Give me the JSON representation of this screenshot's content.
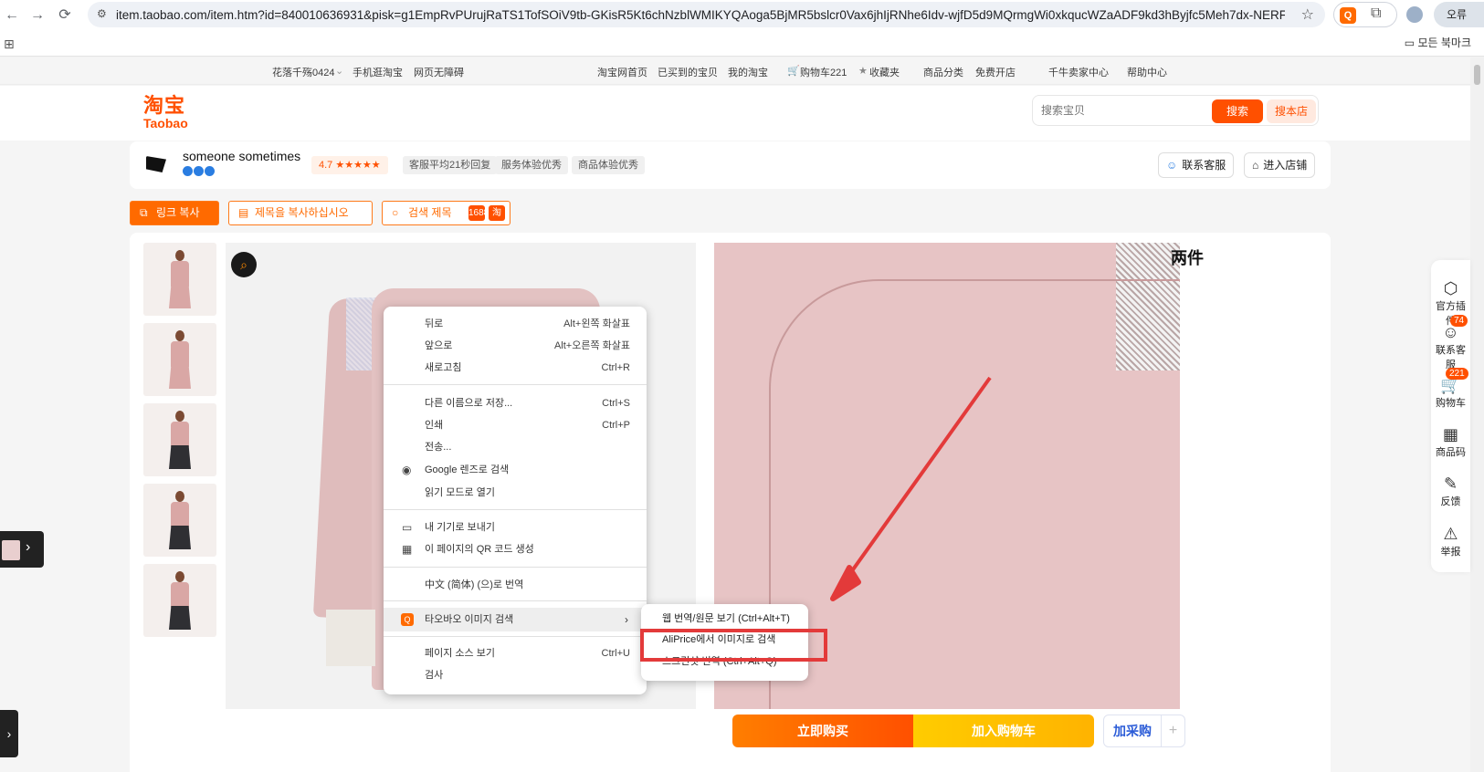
{
  "browser": {
    "url": "item.taobao.com/item.htm?id=840010636931&pisk=g1EmpRvPUrujRaTS1TofSOiV9tb-GKisR5Kt6chNzblWMIKYQAoga5BjMR5bslcr0Vax6jhIjRNhe6Idv-wjfD5d9MQrmgWi0xkqucWZaADF9kd3hByjfc5Meh7dx-NERFZK3AkPEAH...",
    "profile_label": "오류",
    "bookmarks_label": "모든 북마크",
    "ext_ali_label": "Q"
  },
  "topnav": {
    "left": [
      "花落千殇0424",
      "手机逛淘宝",
      "网页无障碍"
    ],
    "right": [
      "淘宝网首页",
      "已买到的宝贝",
      "我的淘宝",
      "购物车221",
      "收藏夹",
      "商品分类",
      "免费开店",
      "千牛卖家中心",
      "帮助中心"
    ]
  },
  "header": {
    "logo_cn": "淘宝",
    "logo_en": "Taobao",
    "search_placeholder": "搜索宝贝",
    "search_button": "搜索",
    "store_button": "搜本店"
  },
  "shop": {
    "name": "someone sometimes",
    "rating": "4.7 ★★★★★",
    "tags": [
      "客服平均21秒回复",
      "服务体验优秀",
      "商品体验优秀"
    ],
    "contact_button": "联系客服",
    "enter_button": "进入店铺"
  },
  "tools": {
    "copy_link": "링크 복사",
    "copy_title": "제목을 복사하십시오",
    "search_title": "검색 제목",
    "mini_a": "1688",
    "mini_b": "淘"
  },
  "product": {
    "title_fragment": "两件",
    "buy_now": "立即购买",
    "add_cart": "加入购物车",
    "purchase": "加采购",
    "plus": "+"
  },
  "sidebar": {
    "items": [
      {
        "label": "官方插件",
        "icon": "plugin-icon"
      },
      {
        "label": "联系客服",
        "icon": "service-icon",
        "badge": "74"
      },
      {
        "label": "购物车",
        "icon": "cart-icon",
        "badge": "221"
      },
      {
        "label": "商品码",
        "icon": "qr-icon"
      },
      {
        "label": "反馈",
        "icon": "edit-icon"
      },
      {
        "label": "举报",
        "icon": "warning-icon"
      }
    ]
  },
  "context_menu": {
    "items": [
      {
        "label": "뒤로",
        "shortcut": "Alt+왼쪽 화살표"
      },
      {
        "label": "앞으로",
        "shortcut": "Alt+오른쪽 화살표"
      },
      {
        "label": "새로고침",
        "shortcut": "Ctrl+R"
      },
      {
        "label": "다른 이름으로 저장...",
        "shortcut": "Ctrl+S"
      },
      {
        "label": "인쇄",
        "shortcut": "Ctrl+P"
      },
      {
        "label": "전송...",
        "shortcut": ""
      },
      {
        "label": "Google 렌즈로 검색",
        "shortcut": ""
      },
      {
        "label": "읽기 모드로 열기",
        "shortcut": ""
      },
      {
        "label": "내 기기로 보내기",
        "shortcut": ""
      },
      {
        "label": "이 페이지의 QR 코드 생성",
        "shortcut": ""
      },
      {
        "label": "中文 (简体) (으)로 번역",
        "shortcut": ""
      },
      {
        "label": "타오바오 이미지 검색",
        "shortcut": ""
      },
      {
        "label": "페이지 소스 보기",
        "shortcut": "Ctrl+U"
      },
      {
        "label": "검사",
        "shortcut": ""
      }
    ]
  },
  "submenu": {
    "items": [
      "웹 번역/원문 보기 (Ctrl+Alt+T)",
      "AliPrice에서 이미지로 검색",
      "스크린샷 번역 (Ctrl+Alt+Q)"
    ]
  },
  "colors": {
    "accent": "#ff5000",
    "highlight": "#e33a3a",
    "sweater": "#e7c4c5"
  }
}
